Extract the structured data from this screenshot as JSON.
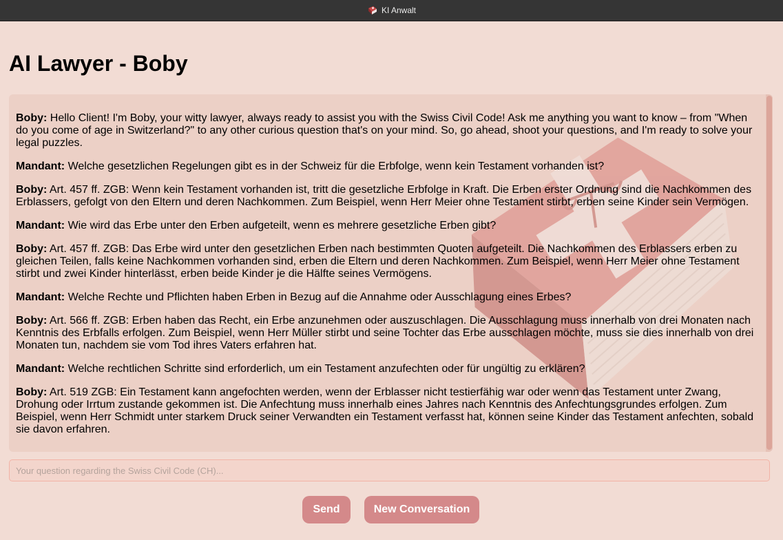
{
  "window": {
    "title": "KI Anwalt",
    "icon": "swiss-law-book-icon"
  },
  "page": {
    "title": "AI Lawyer - Boby"
  },
  "conversation": [
    {
      "speaker": "Boby:",
      "text": "Hello Client! I'm Boby, your witty lawyer, always ready to assist you with the Swiss Civil Code! Ask me anything you want to know – from \"When do you come of age in Switzerland?\" to any other curious question that's on your mind. So, go ahead, shoot your questions, and I'm ready to solve your legal puzzles."
    },
    {
      "speaker": "Mandant:",
      "text": "Welche gesetzlichen Regelungen gibt es in der Schweiz für die Erbfolge, wenn kein Testament vorhanden ist?"
    },
    {
      "speaker": "Boby:",
      "text": "Art. 457 ff. ZGB: Wenn kein Testament vorhanden ist, tritt die gesetzliche Erbfolge in Kraft. Die Erben erster Ordnung sind die Nachkommen des Erblassers, gefolgt von den Eltern und deren Nachkommen. Zum Beispiel, wenn Herr Meier ohne Testament stirbt, erben seine Kinder sein Vermögen."
    },
    {
      "speaker": "Mandant:",
      "text": "Wie wird das Erbe unter den Erben aufgeteilt, wenn es mehrere gesetzliche Erben gibt?"
    },
    {
      "speaker": "Boby:",
      "text": "Art. 457 ff. ZGB: Das Erbe wird unter den gesetzlichen Erben nach bestimmten Quoten aufgeteilt. Die Nachkommen des Erblassers erben zu gleichen Teilen, falls keine Nachkommen vorhanden sind, erben die Eltern und deren Nachkommen. Zum Beispiel, wenn Herr Meier ohne Testament stirbt und zwei Kinder hinterlässt, erben beide Kinder je die Hälfte seines Vermögens."
    },
    {
      "speaker": "Mandant:",
      "text": "Welche Rechte und Pflichten haben Erben in Bezug auf die Annahme oder Ausschlagung eines Erbes?"
    },
    {
      "speaker": "Boby:",
      "text": "Art. 566 ff. ZGB: Erben haben das Recht, ein Erbe anzunehmen oder auszuschlagen. Die Ausschlagung muss innerhalb von drei Monaten nach Kenntnis des Erbfalls erfolgen. Zum Beispiel, wenn Herr Müller stirbt und seine Tochter das Erbe ausschlagen möchte, muss sie dies innerhalb von drei Monaten tun, nachdem sie vom Tod ihres Vaters erfahren hat."
    },
    {
      "speaker": "Mandant:",
      "text": "Welche rechtlichen Schritte sind erforderlich, um ein Testament anzufechten oder für ungültig zu erklären?"
    },
    {
      "speaker": "Boby:",
      "text": "Art. 519 ZGB: Ein Testament kann angefochten werden, wenn der Erblasser nicht testierfähig war oder wenn das Testament unter Zwang, Drohung oder Irrtum zustande gekommen ist. Die Anfechtung muss innerhalb eines Jahres nach Kenntnis des Anfechtungsgrundes erfolgen. Zum Beispiel, wenn Herr Schmidt unter starkem Druck seiner Verwandten ein Testament verfasst hat, können seine Kinder das Testament anfechten, sobald sie davon erfahren."
    }
  ],
  "input": {
    "placeholder": "Your question regarding the Swiss Civil Code (CH)...",
    "value": ""
  },
  "buttons": {
    "send_label": "Send",
    "new_conversation_label": "New Conversation"
  },
  "colors": {
    "background": "#f2dcd4",
    "chat_background": "#ecd0c6",
    "button": "#d4898a",
    "titlebar": "#353535"
  }
}
